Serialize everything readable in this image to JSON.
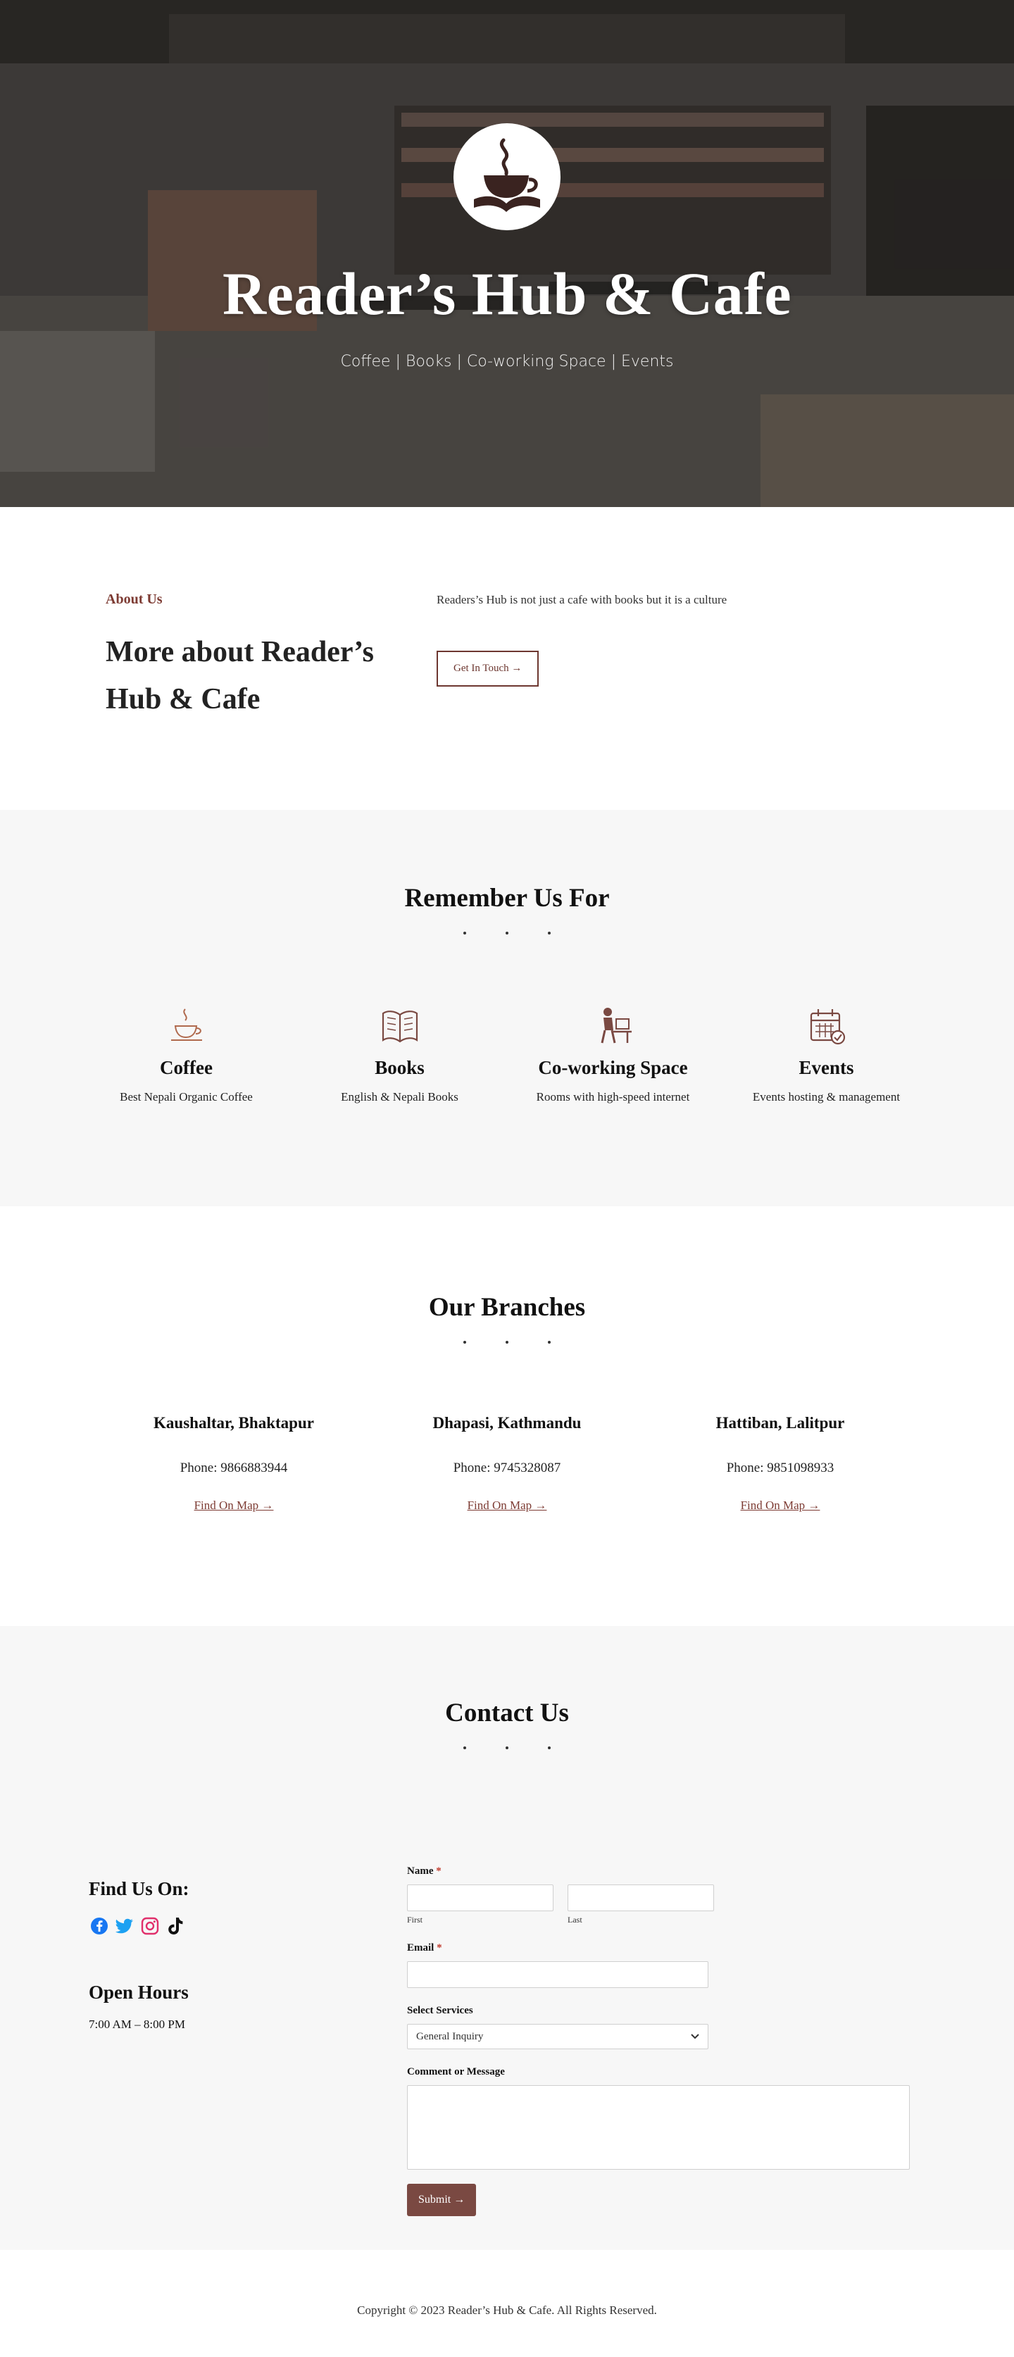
{
  "hero": {
    "title": "Reader’s Hub & Cafe",
    "subtitle": "Coffee | Books | Co-working Space | Events",
    "logo_icon": "coffee-cup-book-logo"
  },
  "about": {
    "label": "About Us",
    "heading": "More about Reader’s Hub & Cafe",
    "text": "Readers’s Hub is not just a cafe with books but it is a culture",
    "button": "Get In Touch →"
  },
  "features": {
    "title": "Remember Us For",
    "items": [
      {
        "icon": "coffee-icon",
        "title": "Coffee",
        "desc": "Best Nepali Organic Coffee"
      },
      {
        "icon": "book-icon",
        "title": "Books",
        "desc": "English & Nepali Books"
      },
      {
        "icon": "coworking-icon",
        "title": "Co-working Space",
        "desc": "Rooms with high-speed internet"
      },
      {
        "icon": "calendar-icon",
        "title": "Events",
        "desc": "Events hosting & management"
      }
    ]
  },
  "branches": {
    "title": "Our Branches",
    "items": [
      {
        "name": "Kaushaltar, Bhaktapur",
        "phone": "Phone: 9866883944",
        "link": "Find On Map →"
      },
      {
        "name": "Dhapasi, Kathmandu",
        "phone": "Phone: 9745328087",
        "link": "Find On Map →"
      },
      {
        "name": "Hattiban, Lalitpur",
        "phone": "Phone: 9851098933",
        "link": "Find On Map →"
      }
    ]
  },
  "contact": {
    "title": "Contact Us",
    "find_us": "Find Us On:",
    "social": [
      "facebook-icon",
      "twitter-icon",
      "instagram-icon",
      "tiktok-icon"
    ],
    "hours_title": "Open Hours",
    "hours": "7:00 AM – 8:00 PM",
    "form": {
      "name_label": "Name",
      "required_mark": "*",
      "first_label": "First",
      "last_label": "Last",
      "email_label": "Email",
      "services_label": "Select Services",
      "services_value": "General Inquiry",
      "message_label": "Comment or Message",
      "submit": "Submit →"
    }
  },
  "footer": {
    "copyright": "Copyright © 2023 Reader’s Hub & Cafe. All Rights Reserved."
  },
  "colors": {
    "accent": "#7d3b33",
    "button": "#7a4942",
    "section_bg": "#f7f7f7"
  }
}
